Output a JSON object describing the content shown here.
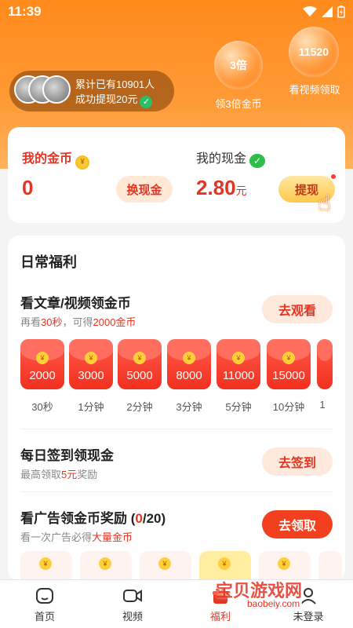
{
  "status": {
    "time": "11:39"
  },
  "progress": {
    "line1": "累计已有10901人",
    "line2": "成功提现20元",
    "check": "✓"
  },
  "bubbles": [
    {
      "value": "3倍",
      "caption": "领3倍金币"
    },
    {
      "value": "11520",
      "caption": "看视频领取"
    }
  ],
  "wallet": {
    "coins_label": "我的金币",
    "coins_value": "0",
    "exchange_button": "换现金",
    "cash_label": "我的现金",
    "cash_value": "2.80",
    "cash_unit": "元",
    "withdraw_button": "提现"
  },
  "daily": {
    "title": "日常福利",
    "task_read": {
      "title": "看文章/视频领金币",
      "sub_pre": "再看",
      "sub_time": "30秒",
      "sub_mid": "，可得",
      "sub_reward": "2000金币",
      "button": "去观看"
    },
    "envelopes": [
      {
        "amount": "2000",
        "label": "30秒"
      },
      {
        "amount": "3000",
        "label": "1分钟"
      },
      {
        "amount": "5000",
        "label": "2分钟"
      },
      {
        "amount": "8000",
        "label": "3分钟"
      },
      {
        "amount": "11000",
        "label": "5分钟"
      },
      {
        "amount": "15000",
        "label": "10分钟"
      },
      {
        "amount": "",
        "label": "1"
      }
    ],
    "task_signin": {
      "title": "每日签到领现金",
      "sub_pre": "最高领取",
      "sub_reward": "5元",
      "sub_post": "奖励",
      "button": "去签到"
    },
    "task_ads": {
      "title_pre": "看广告领金币奖励 (",
      "title_count": "0",
      "title_post": "/20)",
      "sub_pre": "看一次广告必得",
      "sub_reward": "大量金币",
      "button": "去领取"
    }
  },
  "tabs": [
    {
      "label": "首页",
      "icon": "home-icon"
    },
    {
      "label": "视频",
      "icon": "video-icon"
    },
    {
      "label": "福利",
      "icon": "gift-icon"
    },
    {
      "label": "未登录",
      "icon": "user-icon"
    }
  ],
  "watermark": {
    "text": "宝贝游戏网",
    "url": "baobeiy.com"
  },
  "colors": {
    "accent": "#e33524",
    "hero": "#ff8a1c",
    "button_solid": "#f2401e"
  }
}
